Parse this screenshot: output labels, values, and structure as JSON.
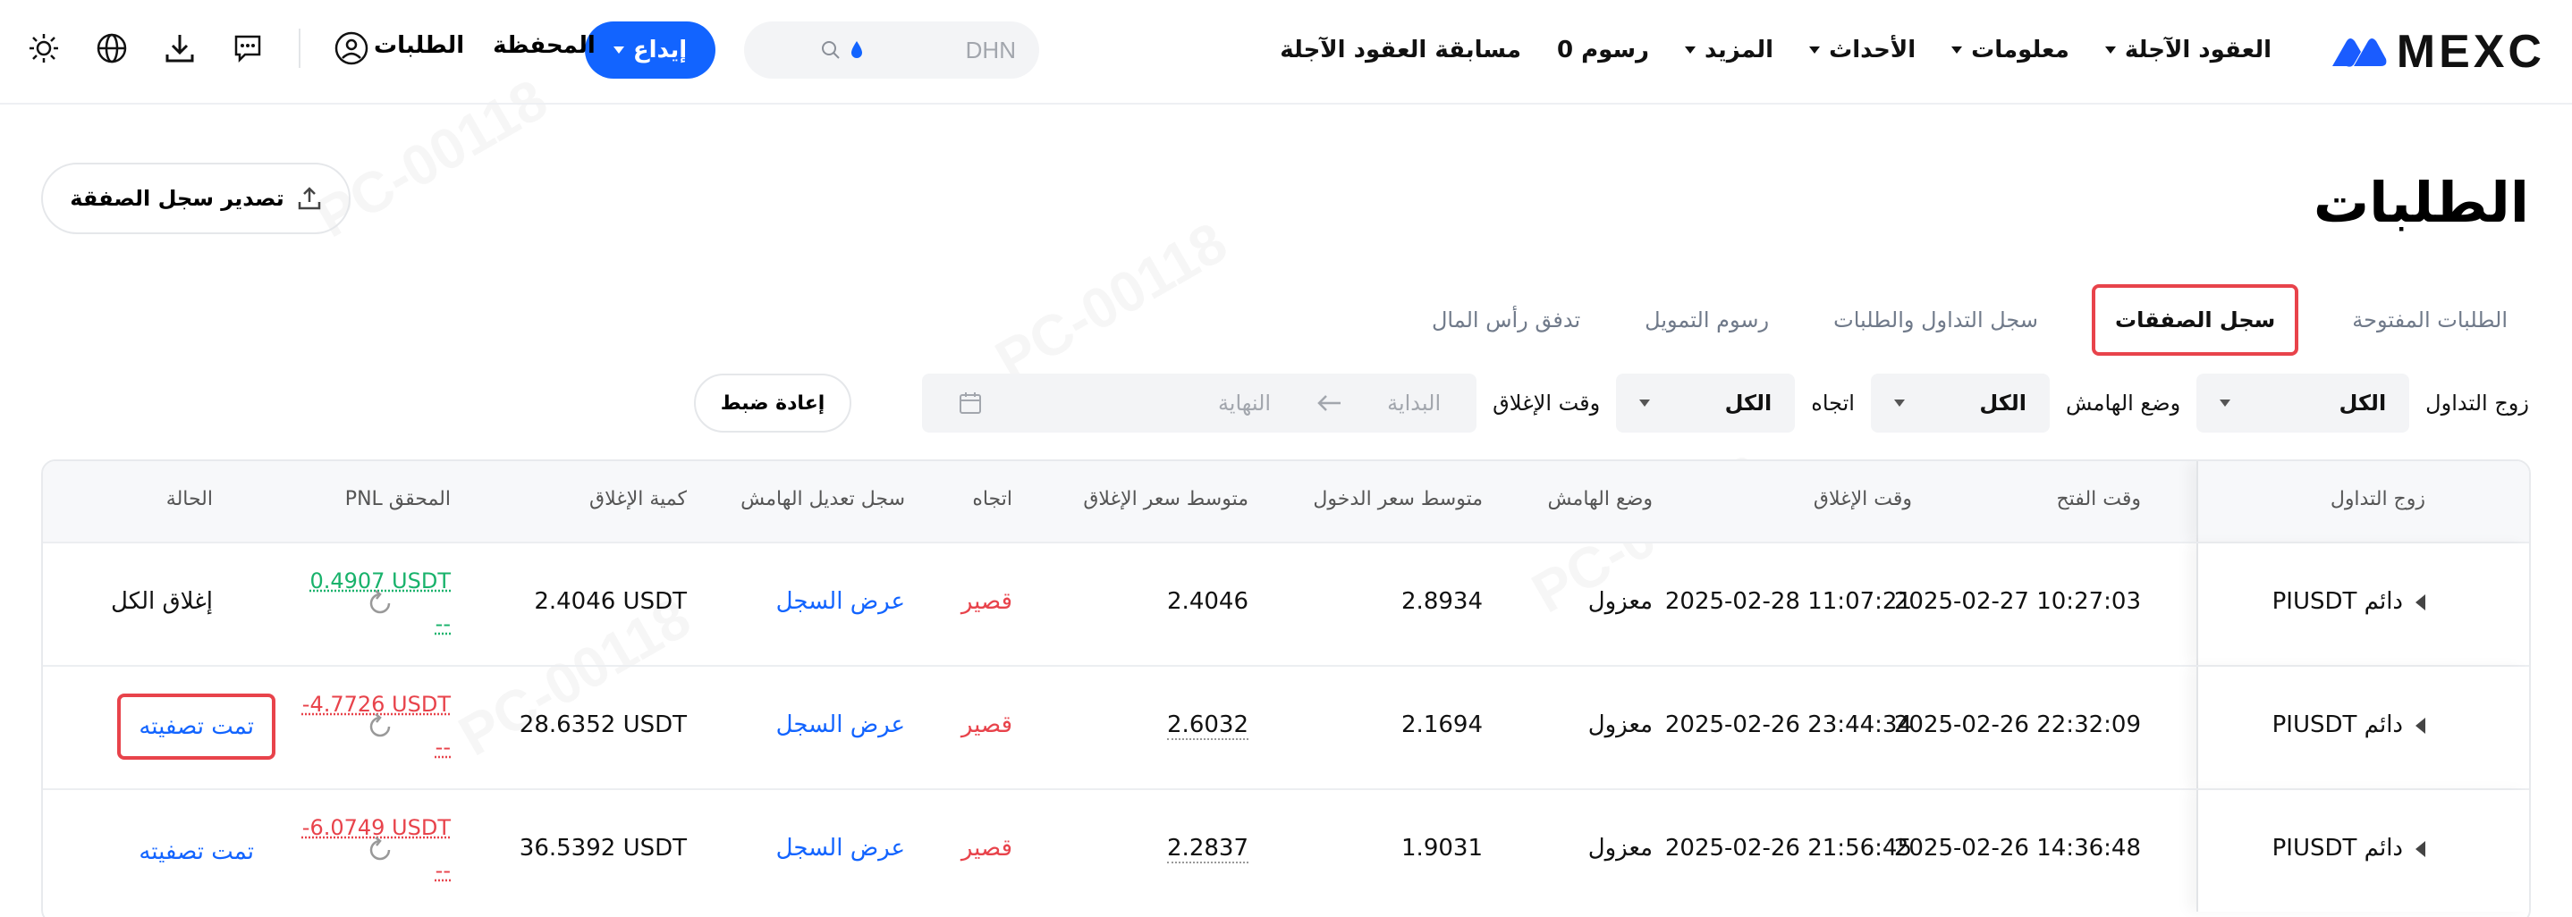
{
  "header": {
    "brand": "MEXC",
    "nav": [
      {
        "label": "العقود الآجلة",
        "caret": true
      },
      {
        "label": "معلومات",
        "caret": true
      },
      {
        "label": "الأحداث",
        "caret": true
      },
      {
        "label": "المزيد",
        "caret": true
      },
      {
        "label": "0 رسوم",
        "caret": false
      },
      {
        "label": "مسابقة العقود الآجلة",
        "caret": false
      }
    ],
    "search_placeholder": "DHN",
    "deposit_label": "إيداع",
    "wallet_label": "المحفظة",
    "orders_label": "الطلبات",
    "icons": [
      "profile-icon",
      "chat-icon",
      "download-icon",
      "globe-icon",
      "theme-sun-icon"
    ]
  },
  "page": {
    "title": "الطلبات",
    "export_label": "تصدير سجل الصفقة",
    "watermark": "PC-00118"
  },
  "tabs": [
    {
      "label": "الطلبات المفتوحة",
      "active": false
    },
    {
      "label": "سجل الصفقات",
      "active": true
    },
    {
      "label": "سجل التداول والطلبات",
      "active": false
    },
    {
      "label": "رسوم التمويل",
      "active": false
    },
    {
      "label": "تدفق رأس المال",
      "active": false
    }
  ],
  "filters": {
    "pair_label": "زوج التداول",
    "pair_value": "الكل",
    "margin_label": "وضع الهامش",
    "margin_value": "الكل",
    "direction_label": "اتجاه",
    "direction_value": "الكل",
    "close_time_label": "وقت الإغلاق",
    "start_placeholder": "البداية",
    "end_placeholder": "النهاية",
    "reset_label": "إعادة ضبط"
  },
  "table": {
    "headers": {
      "pair": "زوج التداول",
      "open_time": "وقت الفتح",
      "close_time": "وقت الإغلاق",
      "margin_mode": "وضع الهامش",
      "avg_entry": "متوسط سعر الدخول",
      "avg_close": "متوسط سعر الإغلاق",
      "direction": "اتجاه",
      "margin_log": "سجل تعديل الهامش",
      "close_qty": "كمية الإغلاق",
      "pnl": "PNL المحقق",
      "status": "الحالة"
    },
    "rows": [
      {
        "pair": "PIUSDT دائم",
        "open_time": "2025-02-27 10:27:03",
        "close_time": "2025-02-28 11:07:21",
        "margin_mode": "معزول",
        "avg_entry": "2.8934",
        "avg_close": "2.4046",
        "direction": "قصير",
        "margin_log": "عرض السجل",
        "close_qty": "2.4046 USDT",
        "pnl": "0.4907 USDT",
        "pnl_sub": "--",
        "pnl_positive": true,
        "status": "إغلاق الكل",
        "status_link": false
      },
      {
        "pair": "PIUSDT دائم",
        "open_time": "2025-02-26 22:32:09",
        "close_time": "2025-02-26 23:44:34",
        "margin_mode": "معزول",
        "avg_entry": "2.1694",
        "avg_close": "2.6032",
        "direction": "قصير",
        "margin_log": "عرض السجل",
        "close_qty": "28.6352 USDT",
        "pnl": "-4.7726 USDT",
        "pnl_sub": "--",
        "pnl_positive": false,
        "status": "تمت تصفيته",
        "status_link": true
      },
      {
        "pair": "PIUSDT دائم",
        "open_time": "2025-02-26 14:36:48",
        "close_time": "2025-02-26 21:56:45",
        "margin_mode": "معزول",
        "avg_entry": "1.9031",
        "avg_close": "2.2837",
        "direction": "قصير",
        "margin_log": "عرض السجل",
        "close_qty": "36.5392 USDT",
        "pnl": "-6.0749 USDT",
        "pnl_sub": "--",
        "pnl_positive": false,
        "status": "تمت تصفيته",
        "status_link": true
      }
    ]
  },
  "colors": {
    "accent": "#1264ff",
    "positive": "#18b26b",
    "negative": "#e8434b",
    "highlight_box": "#e8434b"
  }
}
